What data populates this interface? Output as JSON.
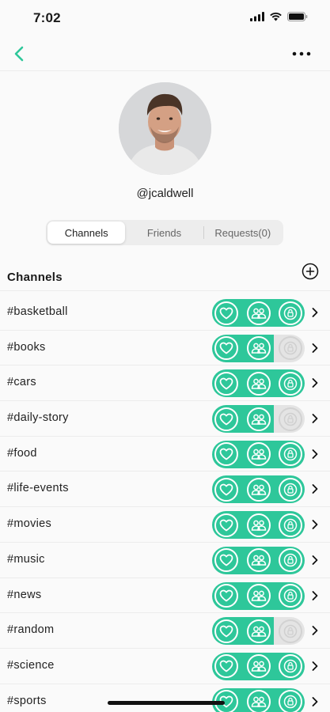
{
  "status": {
    "time": "7:02"
  },
  "profile": {
    "username": "@jcaldwell"
  },
  "tabs": [
    {
      "label": "Channels"
    },
    {
      "label": "Friends"
    },
    {
      "label": "Requests(0)"
    }
  ],
  "section": {
    "title": "Channels"
  },
  "colors": {
    "accent": "#2ec79a",
    "off": "#e4e4e4"
  },
  "channels": [
    {
      "name": "#basketball",
      "favorite": true,
      "friends": true,
      "private": true
    },
    {
      "name": "#books",
      "favorite": true,
      "friends": true,
      "private": false
    },
    {
      "name": "#cars",
      "favorite": true,
      "friends": true,
      "private": true
    },
    {
      "name": "#daily-story",
      "favorite": true,
      "friends": true,
      "private": false
    },
    {
      "name": "#food",
      "favorite": true,
      "friends": true,
      "private": true
    },
    {
      "name": "#life-events",
      "favorite": true,
      "friends": true,
      "private": true
    },
    {
      "name": "#movies",
      "favorite": true,
      "friends": true,
      "private": true
    },
    {
      "name": "#music",
      "favorite": true,
      "friends": true,
      "private": true
    },
    {
      "name": "#news",
      "favorite": true,
      "friends": true,
      "private": true
    },
    {
      "name": "#random",
      "favorite": true,
      "friends": true,
      "private": false
    },
    {
      "name": "#science",
      "favorite": true,
      "friends": true,
      "private": true
    },
    {
      "name": "#sports",
      "favorite": true,
      "friends": true,
      "private": true
    }
  ]
}
